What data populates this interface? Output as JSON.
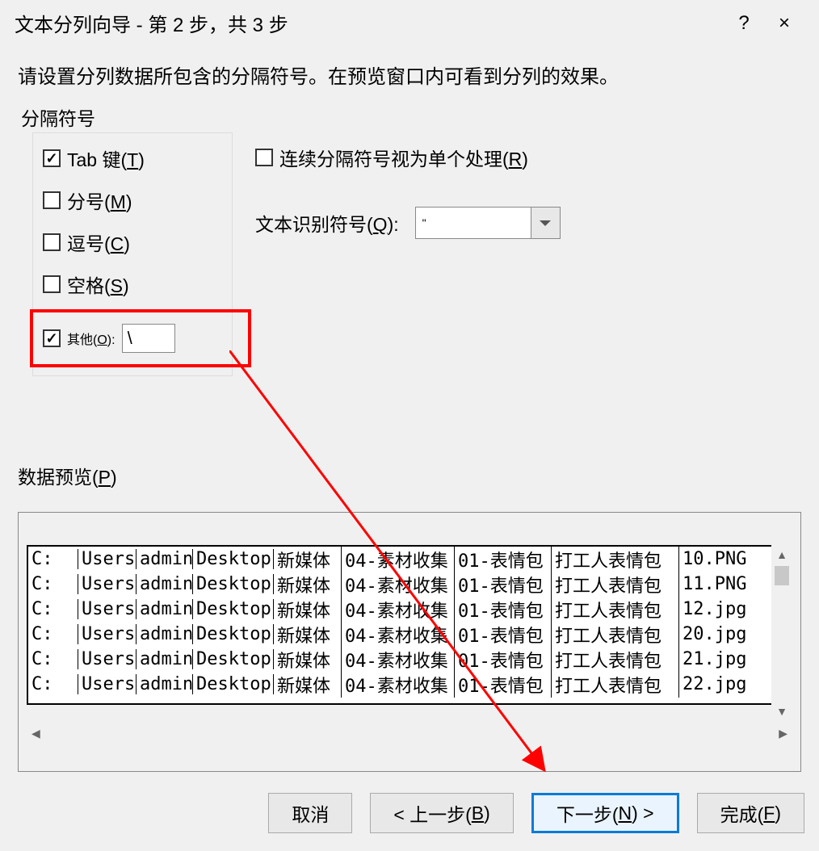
{
  "titlebar": {
    "title": "文本分列向导 - 第 2 步，共 3 步",
    "help": "?",
    "close": "×"
  },
  "instruction": "请设置分列数据所包含的分隔符号。在预览窗口内可看到分列的效果。",
  "delimiters": {
    "legend": "分隔符号",
    "tab": {
      "label": "Tab 键(",
      "accel": "T",
      "suffix": ")",
      "checked": true
    },
    "semicolon": {
      "label": "分号(",
      "accel": "M",
      "suffix": ")",
      "checked": false
    },
    "comma": {
      "label": "逗号(",
      "accel": "C",
      "suffix": ")",
      "checked": false
    },
    "space": {
      "label": "空格(",
      "accel": "S",
      "suffix": ")",
      "checked": false
    },
    "other": {
      "label": "其他(",
      "accel": "O",
      "suffix": "):",
      "checked": true,
      "value": "\\"
    },
    "consecutive": {
      "label": "连续分隔符号视为单个处理(",
      "accel": "R",
      "suffix": ")",
      "checked": false
    },
    "qualifier": {
      "label": "文本识别符号(",
      "accel": "Q",
      "suffix": "):",
      "value": "\""
    }
  },
  "preview": {
    "label": "数据预览(",
    "accel": "P",
    "suffix": ")",
    "columns": [
      "C:",
      "Users",
      "admin",
      "Desktop",
      "新媒体",
      "04-素材收集",
      "01-表情包",
      "打工人表情包"
    ],
    "rows": [
      [
        "C:",
        "Users",
        "admin",
        "Desktop",
        "新媒体",
        "04-素材收集",
        "01-表情包",
        "打工人表情包",
        "10.PNG"
      ],
      [
        "C:",
        "Users",
        "admin",
        "Desktop",
        "新媒体",
        "04-素材收集",
        "01-表情包",
        "打工人表情包",
        "11.PNG"
      ],
      [
        "C:",
        "Users",
        "admin",
        "Desktop",
        "新媒体",
        "04-素材收集",
        "01-表情包",
        "打工人表情包",
        "12.jpg"
      ],
      [
        "C:",
        "Users",
        "admin",
        "Desktop",
        "新媒体",
        "04-素材收集",
        "01-表情包",
        "打工人表情包",
        "20.jpg"
      ],
      [
        "C:",
        "Users",
        "admin",
        "Desktop",
        "新媒体",
        "04-素材收集",
        "01-表情包",
        "打工人表情包",
        "21.jpg"
      ],
      [
        "C:",
        "Users",
        "admin",
        "Desktop",
        "新媒体",
        "04-素材收集",
        "01-表情包",
        "打工人表情包",
        "22.jpg"
      ]
    ]
  },
  "buttons": {
    "cancel": "取消",
    "back_prefix": "< 上一步(",
    "back_accel": "B",
    "back_suffix": ")",
    "next_prefix": "下一步(",
    "next_accel": "N",
    "next_suffix": ") >",
    "finish_prefix": "完成(",
    "finish_accel": "F",
    "finish_suffix": ")"
  }
}
